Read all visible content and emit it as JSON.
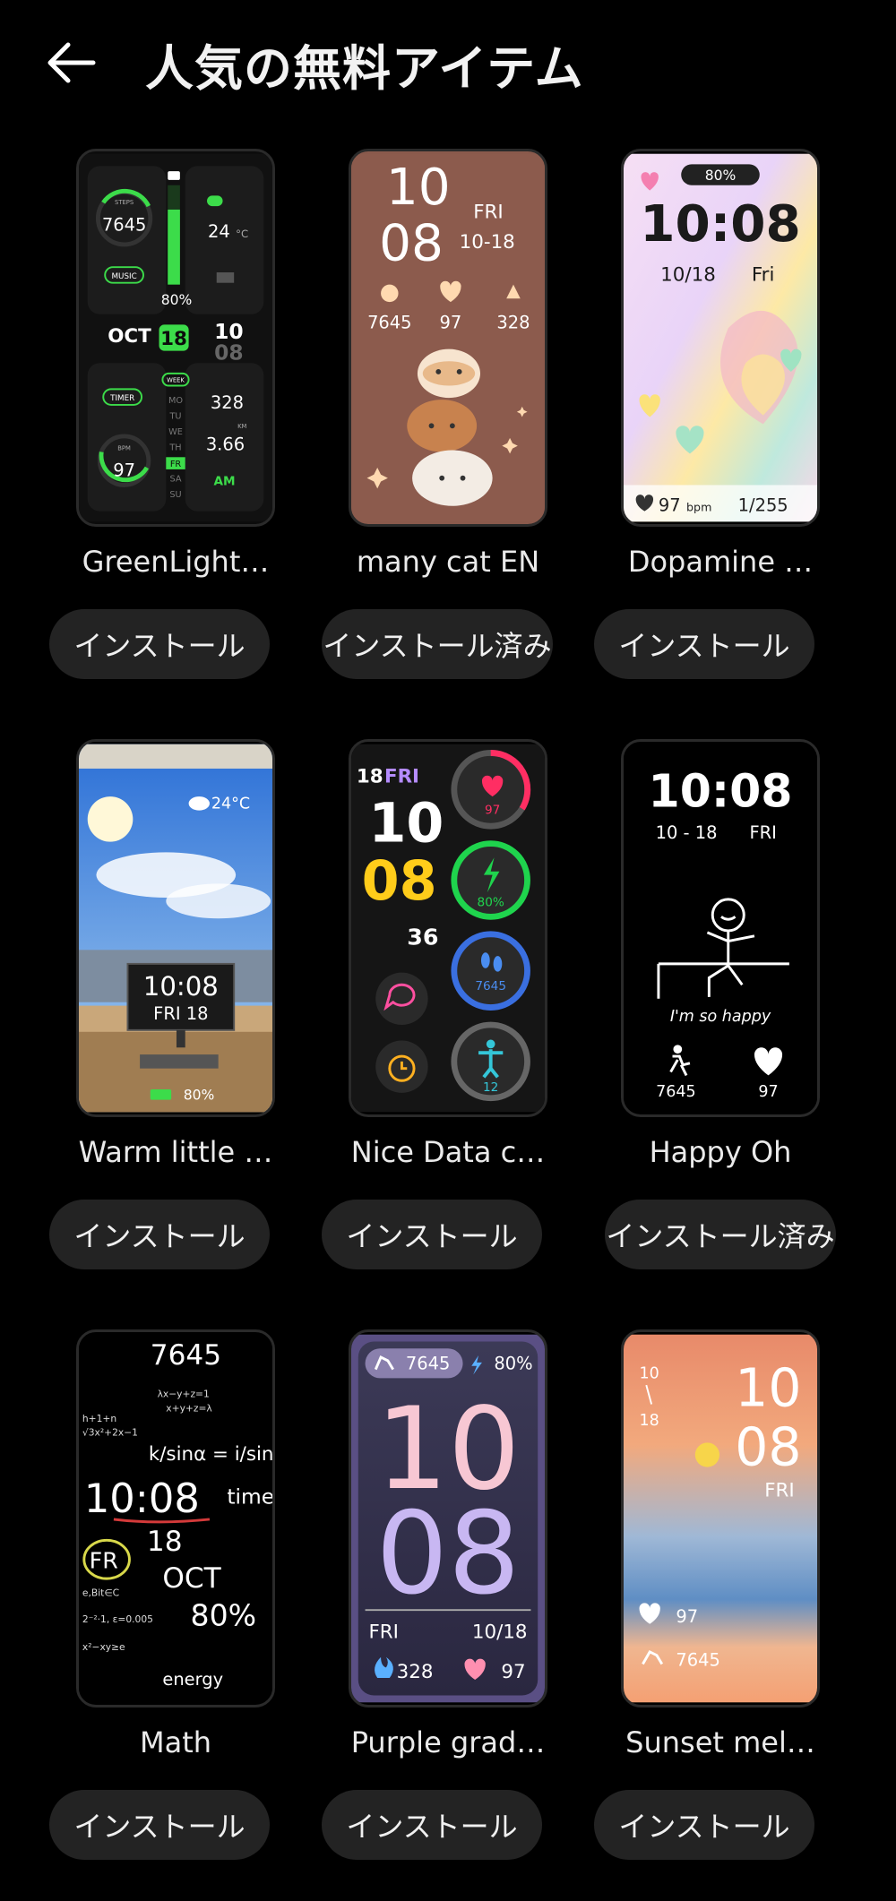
{
  "header": {
    "title": "人気の無料アイテム",
    "back_icon": "arrow-left-icon"
  },
  "items": [
    {
      "name": "GreenLight…",
      "button": "インストール",
      "face": {
        "steps_label": "STEPS",
        "steps": "7645",
        "temp": "24",
        "temp_unit": "°C",
        "music": "MUSIC",
        "battery": "80%",
        "month": "OCT",
        "day": "18",
        "hour": "10",
        "minute": "08",
        "timer": "TIMER",
        "week": "WEEK",
        "calories": "328",
        "distance_label": "KM",
        "distance": "3.66",
        "bpm_label": "BPM",
        "heart": "97",
        "ampm": "AM",
        "weekdays": [
          "MO",
          "TU",
          "WE",
          "TH",
          "FR",
          "SA",
          "SU"
        ]
      }
    },
    {
      "name": "many cat EN",
      "button": "インストール済み",
      "face": {
        "hour": "10",
        "minute": "08",
        "weekday": "FRI",
        "date": "10-18",
        "steps": "7645",
        "heart": "97",
        "calories": "328"
      }
    },
    {
      "name": "Dopamine …",
      "button": "インストール",
      "face": {
        "battery": "80%",
        "time": "10:08",
        "date": "10/18",
        "weekday": "Fri",
        "heart": "97",
        "heart_unit": "bpm",
        "page": "1/255"
      }
    },
    {
      "name": "Warm little …",
      "button": "インストール",
      "face": {
        "temp": "24°C",
        "time": "10:08",
        "day": "FRI 18",
        "battery": "80%"
      }
    },
    {
      "name": "Nice Data c…",
      "button": "インストール",
      "face": {
        "day": "18",
        "weekday": "FRI",
        "hour": "10",
        "minute": "08",
        "seconds": "36",
        "heart": "97",
        "battery": "80%",
        "steps": "7645",
        "stand": "12"
      }
    },
    {
      "name": "Happy Oh",
      "button": "インストール済み",
      "face": {
        "time": "10:08",
        "date": "10 - 18",
        "weekday": "FRI",
        "caption": "I'm so happy",
        "steps": "7645",
        "heart": "97"
      }
    },
    {
      "name": "Math",
      "button": "インストール",
      "face": {
        "steps": "7645",
        "time": "10:08",
        "time_word": "time",
        "weekday": "FR",
        "day": "18",
        "month": "OCT",
        "battery": "80%",
        "energy": "energy"
      }
    },
    {
      "name": "Purple grad…",
      "button": "インストール",
      "face": {
        "steps": "7645",
        "battery": "80%",
        "hour": "10",
        "minute": "08",
        "weekday": "FRI",
        "date": "10/18",
        "calories": "328",
        "heart": "97"
      }
    },
    {
      "name": "Sunset mel…",
      "button": "インストール",
      "face": {
        "month": "10",
        "day": "18",
        "hour": "10",
        "minute": "08",
        "weekday": "FRI",
        "heart": "97",
        "steps": "7645"
      }
    }
  ]
}
